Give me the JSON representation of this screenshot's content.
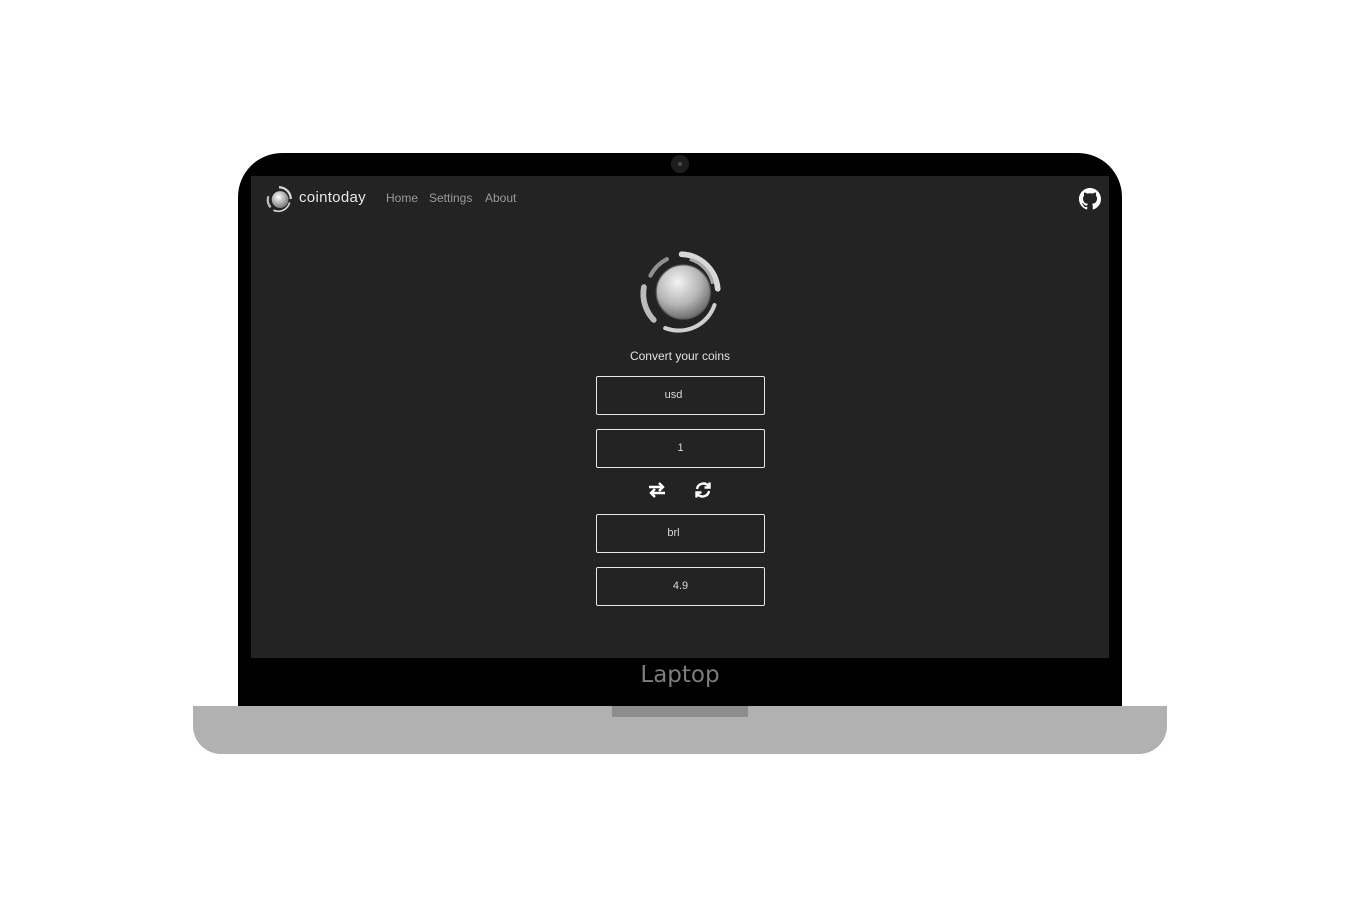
{
  "app": {
    "brand_name": "cointoday",
    "logo_icon": "coin-logo-icon",
    "github_icon": "github-icon"
  },
  "nav": {
    "home_label": "Home",
    "settings_label": "Settings",
    "about_label": "About"
  },
  "converter": {
    "subtitle": "Convert your coins",
    "from_currency": "usd",
    "from_amount": "1",
    "swap_icon": "swap-arrows-icon",
    "refresh_icon": "refresh-icon",
    "to_currency": "brl",
    "to_amount": "4.9"
  },
  "device": {
    "label": "Laptop"
  },
  "colors": {
    "screen_bg": "#232323",
    "bezel": "#000000",
    "base": "#b1b1b1",
    "field_border": "#e6e6e6"
  }
}
